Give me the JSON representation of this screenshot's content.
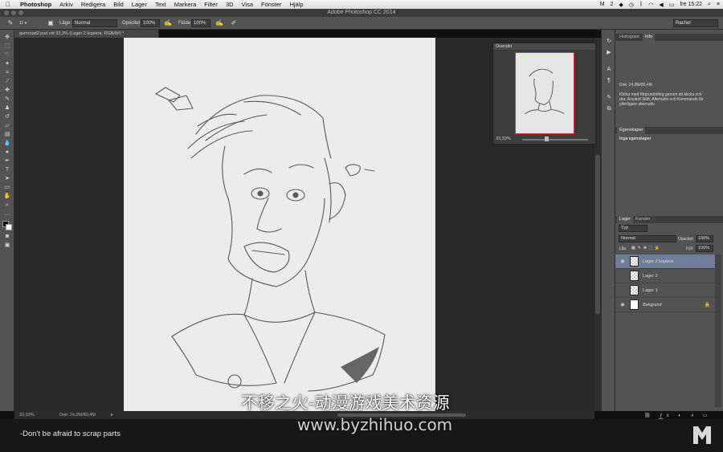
{
  "menubar": {
    "app": "Photoshop",
    "items": [
      "Arkiv",
      "Redigera",
      "Bild",
      "Lager",
      "Text",
      "Markera",
      "Filter",
      "3D",
      "Visa",
      "Fönster",
      "Hjälp"
    ],
    "badge": "2",
    "time": "fre 15:22"
  },
  "window": {
    "title": "Adobe Photoshop CC 2014"
  },
  "options": {
    "brush_size": "11",
    "mode_label": "Läge:",
    "mode_value": "Normal",
    "opacity_label": "Opacitet:",
    "opacity_value": "100%",
    "flow_label": "Flöde:",
    "flow_value": "100%",
    "workspace": "Rachel"
  },
  "document": {
    "tab_title": "gumroad2.psd vid 33,3% (Lager 2 kopiera, RGB/8#) *",
    "zoom": "33,33%",
    "doc_size": "Dok: 24,9M/80,4M"
  },
  "navigator": {
    "title": "Översikt",
    "zoom": "33,33%"
  },
  "info_panel": {
    "tabs": [
      "Histogram",
      "Info"
    ],
    "active_tab": "Info",
    "doc_size": "Dok: 24,9M/80,4M",
    "hint": "Klicka med förgrundsfärg genom att klicka och dra. Använd Skift, Alternativ och Kommando för ytterligare alternativ."
  },
  "properties_panel": {
    "title": "Egenskaper",
    "empty_text": "Inga egenskaper"
  },
  "layers_panel": {
    "tabs": [
      "Lager",
      "Kanaler"
    ],
    "active_tab": "Lager",
    "filter_kind": "Typ",
    "blend_mode": "Normal",
    "opacity_label": "Opacitet:",
    "opacity_value": "100%",
    "lock_label": "Lås:",
    "fill_label": "Fyll:",
    "fill_value": "100%",
    "layers": [
      {
        "name": "Lager 2 kopiera",
        "visible": true,
        "selected": true
      },
      {
        "name": "Lager 2",
        "visible": false,
        "selected": false
      },
      {
        "name": "Lager 1",
        "visible": false,
        "selected": false
      },
      {
        "name": "Bakgrund",
        "visible": true,
        "selected": false
      }
    ]
  },
  "caption": {
    "text": "-Don't be afraid to scrap parts"
  },
  "watermarks": {
    "line1": "不移之火-动漫游戏美术资源",
    "line2": "www.byzhihuo.com"
  },
  "colors": {
    "panel": "#535353",
    "workspace": "#282828",
    "canvas": "#ececec",
    "selection": "#6f7e98",
    "accent_red": "#e0343f"
  }
}
